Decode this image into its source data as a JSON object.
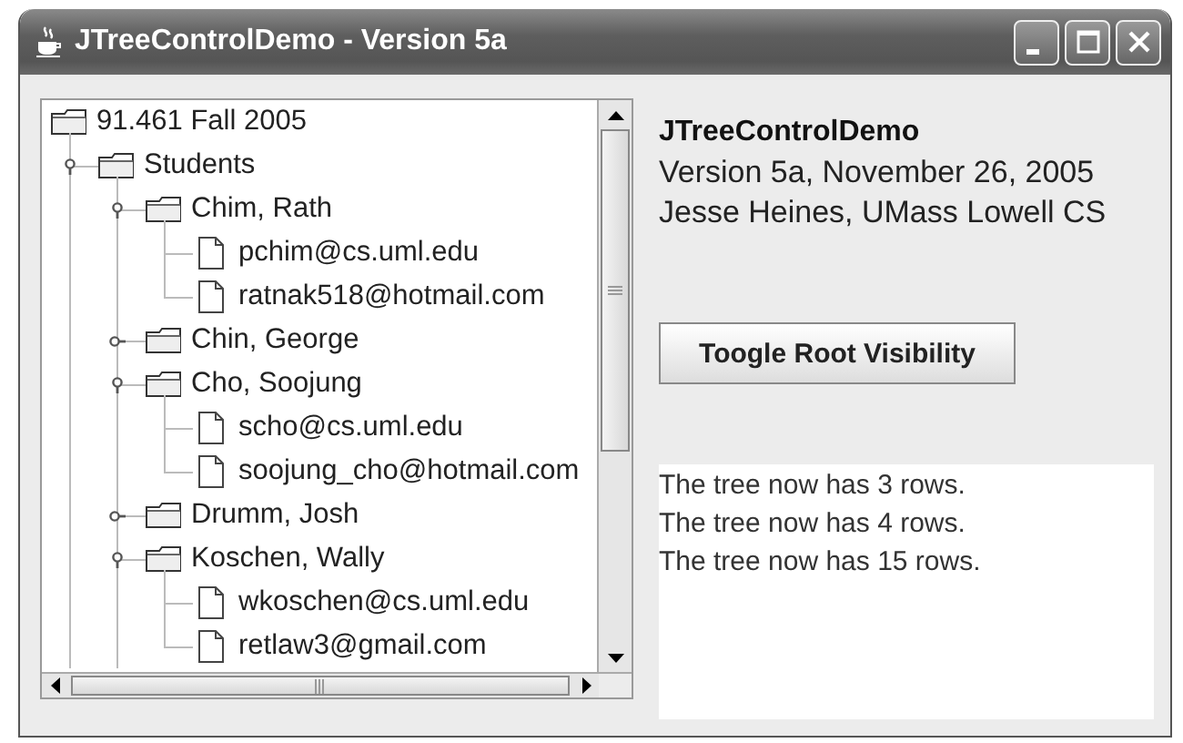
{
  "window": {
    "title": "JTreeControlDemo - Version 5a"
  },
  "tree": {
    "root": {
      "label": "91.461 Fall 2005",
      "kind": "folder",
      "children": [
        {
          "label": "Students",
          "kind": "folder",
          "expanded": true,
          "line_continues": true,
          "children": [
            {
              "label": "Chim, Rath",
              "kind": "folder",
              "expanded": true,
              "children": [
                {
                  "label": "pchim@cs.uml.edu",
                  "kind": "leaf"
                },
                {
                  "label": "ratnak518@hotmail.com",
                  "kind": "leaf"
                }
              ]
            },
            {
              "label": "Chin, George",
              "kind": "folder",
              "expanded": false
            },
            {
              "label": "Cho, Soojung",
              "kind": "folder",
              "expanded": true,
              "children": [
                {
                  "label": "scho@cs.uml.edu",
                  "kind": "leaf"
                },
                {
                  "label": "soojung_cho@hotmail.com",
                  "kind": "leaf"
                }
              ]
            },
            {
              "label": "Drumm, Josh",
              "kind": "folder",
              "expanded": false
            },
            {
              "label": "Koschen, Wally",
              "kind": "folder",
              "expanded": true,
              "line_continues": true,
              "children": [
                {
                  "label": "wkoschen@cs.uml.edu",
                  "kind": "leaf"
                },
                {
                  "label": "retlaw3@gmail.com",
                  "kind": "leaf"
                }
              ]
            }
          ]
        }
      ]
    }
  },
  "info": {
    "title": "JTreeControlDemo",
    "lines": [
      "Version 5a, November 26, 2005",
      "Jesse Heines, UMass Lowell CS"
    ]
  },
  "button": {
    "label": "Toogle Root Visibility"
  },
  "log": {
    "lines": [
      "The tree now has 3 rows.",
      "The tree now has 4 rows.",
      "The tree now has 15 rows."
    ]
  }
}
